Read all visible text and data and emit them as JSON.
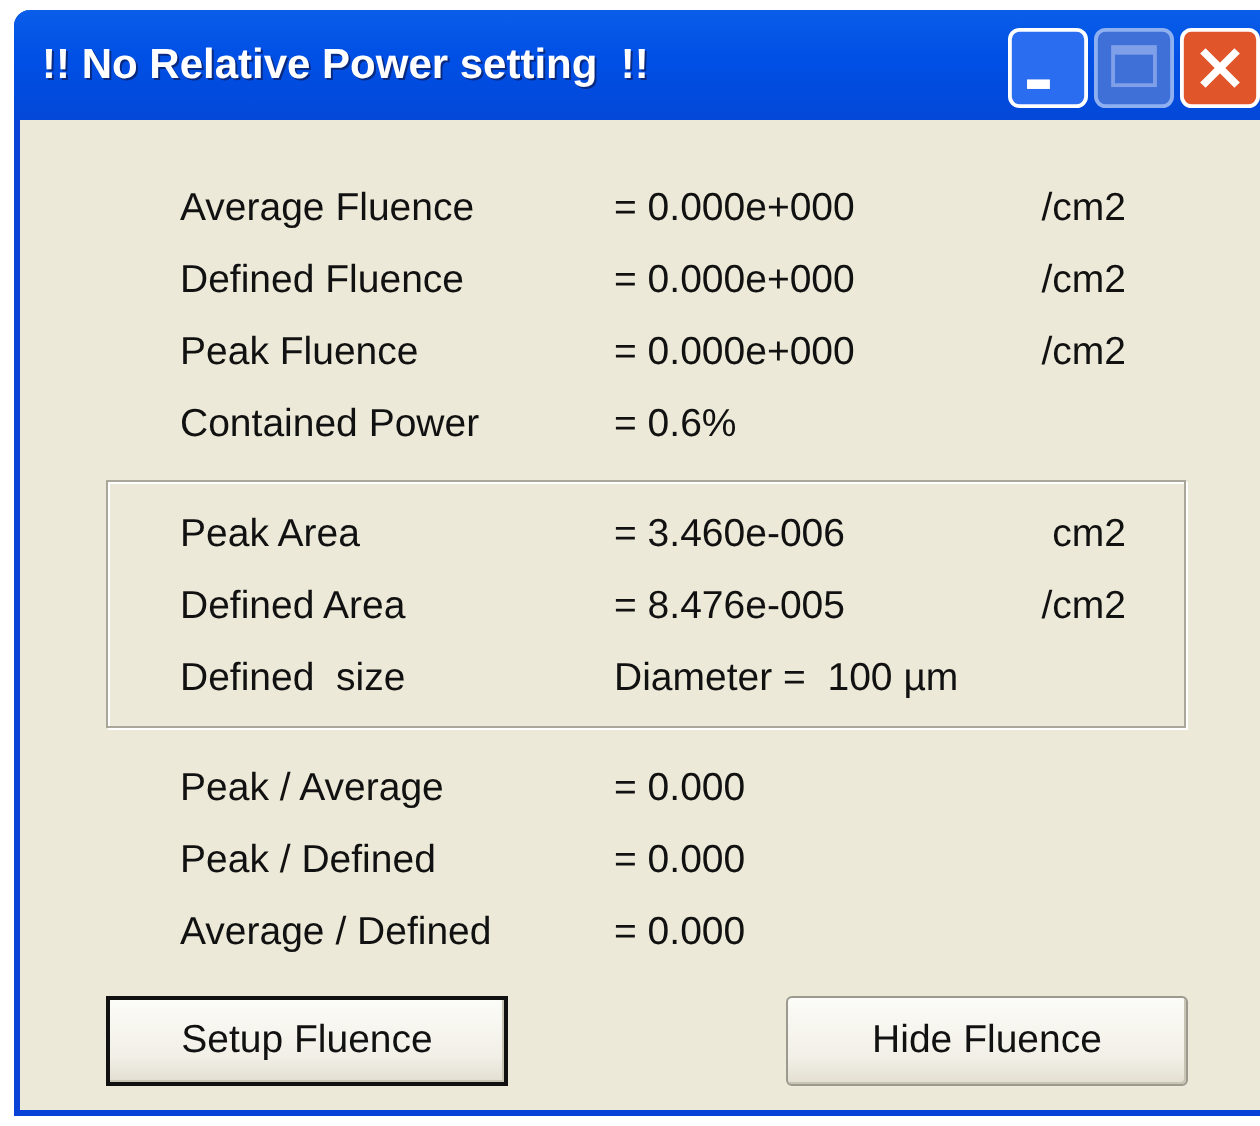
{
  "window": {
    "title": "!! No Relative Power setting  !!"
  },
  "sections": [
    {
      "boxed": false,
      "rows": [
        {
          "label": "Average Fluence",
          "value": "= 0.000e+000",
          "unit": "/cm2"
        },
        {
          "label": "Defined Fluence",
          "value": "= 0.000e+000",
          "unit": "/cm2"
        },
        {
          "label": "Peak Fluence",
          "value": "= 0.000e+000",
          "unit": "/cm2"
        },
        {
          "label": "Contained Power",
          "value": "= 0.6%"
        }
      ]
    },
    {
      "boxed": true,
      "rows": [
        {
          "label": "Peak Area",
          "value": "= 3.460e-006",
          "unit": "cm2"
        },
        {
          "label": "Defined Area",
          "value": "= 8.476e-005",
          "unit": "/cm2"
        },
        {
          "label": "Defined  size",
          "value": "Diameter =  100 µm"
        }
      ]
    },
    {
      "boxed": false,
      "rows": [
        {
          "label": "Peak / Average",
          "value": "= 0.000"
        },
        {
          "label": "Peak / Defined",
          "value": "= 0.000"
        },
        {
          "label": "Average / Defined",
          "value": "= 0.000"
        }
      ]
    }
  ],
  "buttons": [
    {
      "label": "Setup Fluence",
      "default": true
    },
    {
      "label": "Hide Fluence",
      "default": false
    }
  ]
}
